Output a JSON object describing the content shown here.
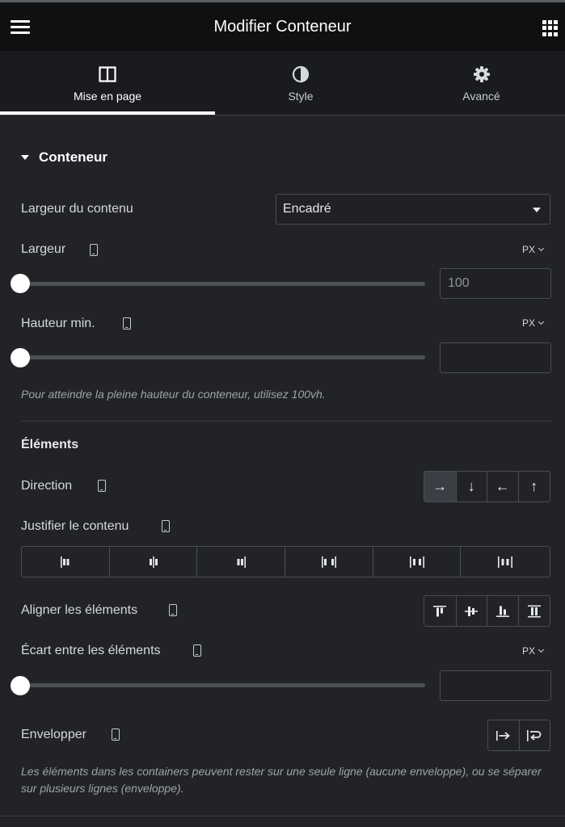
{
  "header": {
    "title": "Modifier Conteneur",
    "menu_icon": "hamburger-icon",
    "apps_icon": "grid-icon"
  },
  "tabs": [
    {
      "label": "Mise en page",
      "icon": "layout-icon",
      "active": true
    },
    {
      "label": "Style",
      "icon": "contrast-icon",
      "active": false
    },
    {
      "label": "Avancé",
      "icon": "gear-icon",
      "active": false
    }
  ],
  "section": {
    "title": "Conteneur"
  },
  "content_width": {
    "label": "Largeur du contenu",
    "value": "Encadré"
  },
  "width": {
    "label": "Largeur",
    "unit": "PX",
    "placeholder": "100",
    "value": ""
  },
  "min_height": {
    "label": "Hauteur min.",
    "unit": "PX",
    "value": "",
    "hint": "Pour atteindre la pleine hauteur du conteneur, utilisez 100vh."
  },
  "elements": {
    "title": "Éléments"
  },
  "direction": {
    "label": "Direction",
    "options": [
      "→",
      "↓",
      "←",
      "↑"
    ],
    "selected": 0
  },
  "justify": {
    "label": "Justifier le contenu"
  },
  "align": {
    "label": "Aligner les éléments"
  },
  "gap": {
    "label": "Écart entre les éléments",
    "unit": "PX",
    "value": ""
  },
  "wrap": {
    "label": "Envelopper",
    "hint": "Les éléments dans les containers peuvent rester sur une seule ligne (aucune enveloppe), ou se séparer sur plusieurs lignes (enveloppe)."
  },
  "colors": {
    "background": "#222327",
    "header": "#0f1012",
    "accent": "#ffffff"
  }
}
